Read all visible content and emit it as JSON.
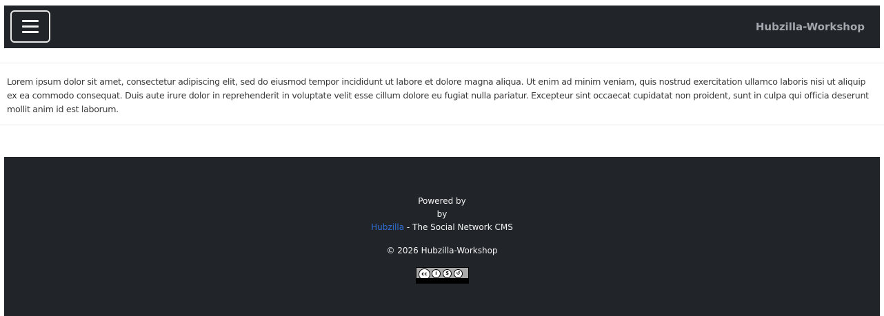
{
  "header": {
    "menu_icon": "hamburger-menu-icon",
    "site_name": "Hubzilla-Workshop"
  },
  "content": {
    "text": "Lorem ipsum dolor sit amet, consectetur adipiscing elit, sed do eiusmod tempor incididunt ut labore et dolore magna aliqua. Ut enim ad minim veniam, quis nostrud exercitation ullamco laboris nisi ut aliquip ex ea commodo consequat. Duis aute irure dolor in reprehenderit in voluptate velit esse cillum dolore eu fugiat nulla pariatur. Excepteur sint occaecat cupidatat non proident, sunt in culpa qui officia deserunt mollit anim id est laborum."
  },
  "footer": {
    "powered_by": "Powered by",
    "by": "by",
    "hub_link": "Hubzilla",
    "hub_suffix": " - The Social Network CMS",
    "copyright": "© 2026 Hubzilla-Workshop",
    "license_icon": "cc-by-nc-sa-license-badge"
  },
  "colors": {
    "bar_bg": "#212529",
    "link": "#2f6fd6",
    "brand_text": "#a3a7ad"
  }
}
